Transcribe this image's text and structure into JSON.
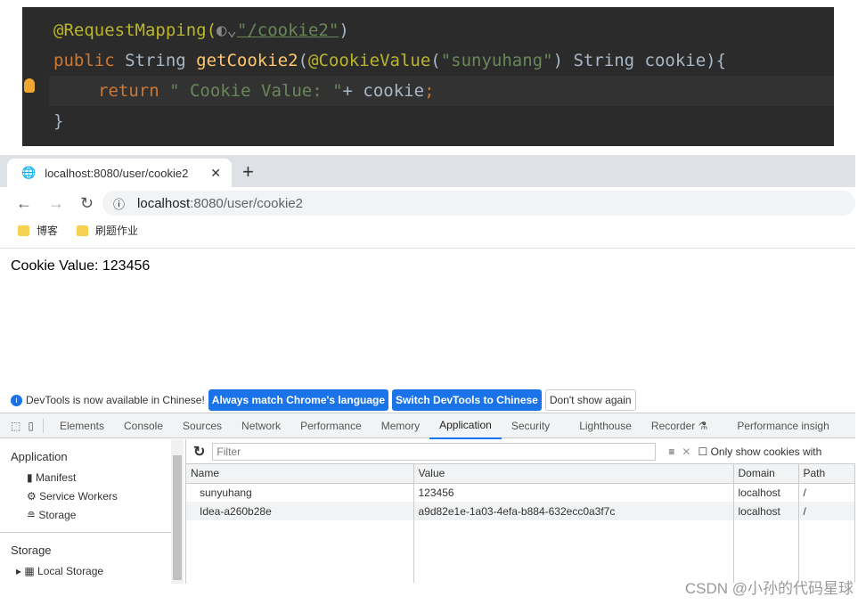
{
  "code": {
    "line1": {
      "annotation": "@RequestMapping(",
      "path": "\"/cookie2\"",
      "close": ")"
    },
    "line2": {
      "kw": "public",
      "type": " String ",
      "fn": "getCookie2",
      "p1": "(",
      "ann": "@CookieValue",
      "p2": "(",
      "str": "\"sunyuhang\"",
      "rest": ") String cookie){"
    },
    "line3": {
      "kw": "return",
      "str": " \" Cookie Value: \"",
      "rest": "+ cookie",
      "semi": ";"
    },
    "line4": "}"
  },
  "browser": {
    "tab_title": "localhost:8080/user/cookie2",
    "url_host": "localhost",
    "url_rest": ":8080/user/cookie2",
    "bookmarks": [
      "博客",
      "刷题作业"
    ]
  },
  "page": {
    "text": "Cookie Value: 123456"
  },
  "devtools": {
    "info": "DevTools is now available in Chinese!",
    "btn_match": "Always match Chrome's language",
    "btn_switch": "Switch DevTools to Chinese",
    "btn_dont": "Don't show again",
    "tabs": [
      "Elements",
      "Console",
      "Sources",
      "Network",
      "Performance",
      "Memory",
      "Application",
      "Security",
      "Lighthouse",
      "Recorder ⚗",
      "Performance insigh"
    ],
    "active_tab": "Application",
    "sidebar": {
      "h1": "Application",
      "items": [
        "Manifest",
        "Service Workers",
        "Storage"
      ],
      "h2": "Storage",
      "local": "Local Storage"
    },
    "filter_placeholder": "Filter",
    "only_show": "Only show cookies with",
    "columns": [
      "Name",
      "Value",
      "Domain",
      "Path"
    ],
    "rows": [
      [
        "sunyuhang",
        "123456",
        "localhost",
        "/"
      ],
      [
        "Idea-a260b28e",
        "a9d82e1e-1a03-4efa-b884-632ecc0a3f7c",
        "localhost",
        "/"
      ]
    ]
  },
  "watermark": "CSDN @小孙的代码星球"
}
